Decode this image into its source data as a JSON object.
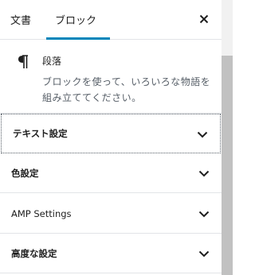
{
  "tabs": {
    "document_label": "文書",
    "block_label": "ブロック",
    "active": "block"
  },
  "close_icon": "close-icon",
  "block_card": {
    "icon": "pilcrow-icon",
    "title": "段落",
    "description": "ブロックを使って、いろいろな物語を組み立ててください。"
  },
  "sections": [
    {
      "label": "テキスト設定",
      "icon": "chevron-down-icon",
      "focused": true
    },
    {
      "label": "色設定",
      "icon": "chevron-down-icon",
      "focused": false
    },
    {
      "label": "AMP Settings",
      "icon": "chevron-down-icon",
      "focused": false
    },
    {
      "label": "高度な設定",
      "icon": "chevron-down-icon",
      "focused": false
    }
  ],
  "colors": {
    "accent": "#0085ba",
    "text": "#1e1e1e",
    "muted": "#555d66",
    "border": "#e2e4e7"
  }
}
